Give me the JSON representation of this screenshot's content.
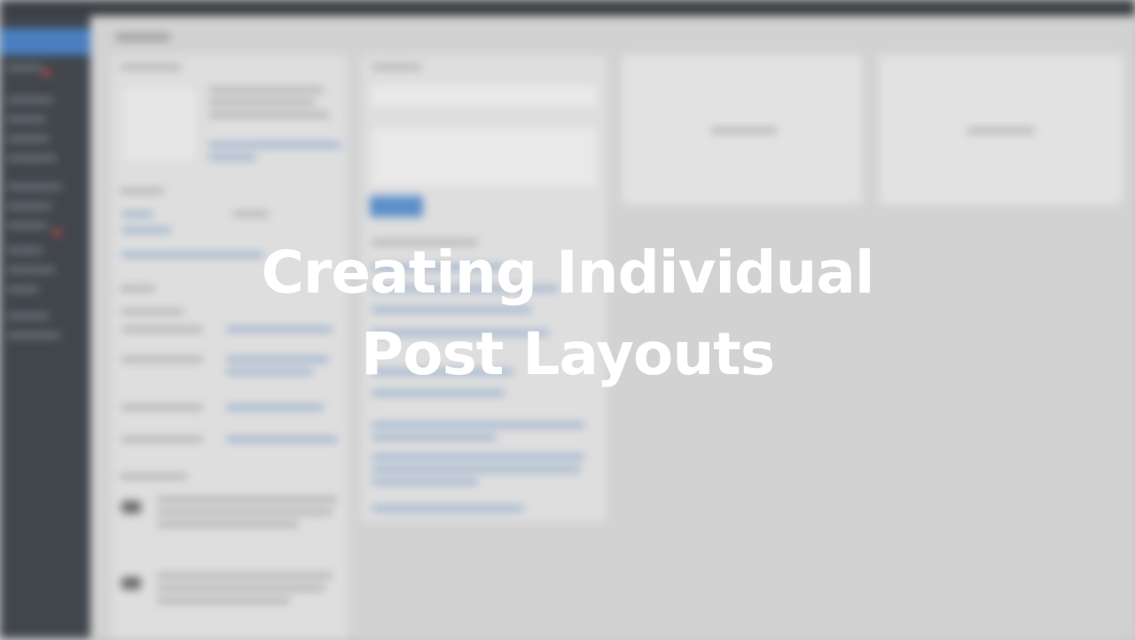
{
  "overlay": {
    "title_line_1": "Creating Individual",
    "title_line_2": "Post Layouts"
  },
  "colors": {
    "background": "#c9c9c9",
    "sidebar": "#40464c",
    "sidebar_active": "#4a7fc0",
    "primary_button": "#5c8fc9",
    "title_text": "#ffffff"
  },
  "icons": [
    "notification-dot-icon",
    "avatar-icon"
  ]
}
